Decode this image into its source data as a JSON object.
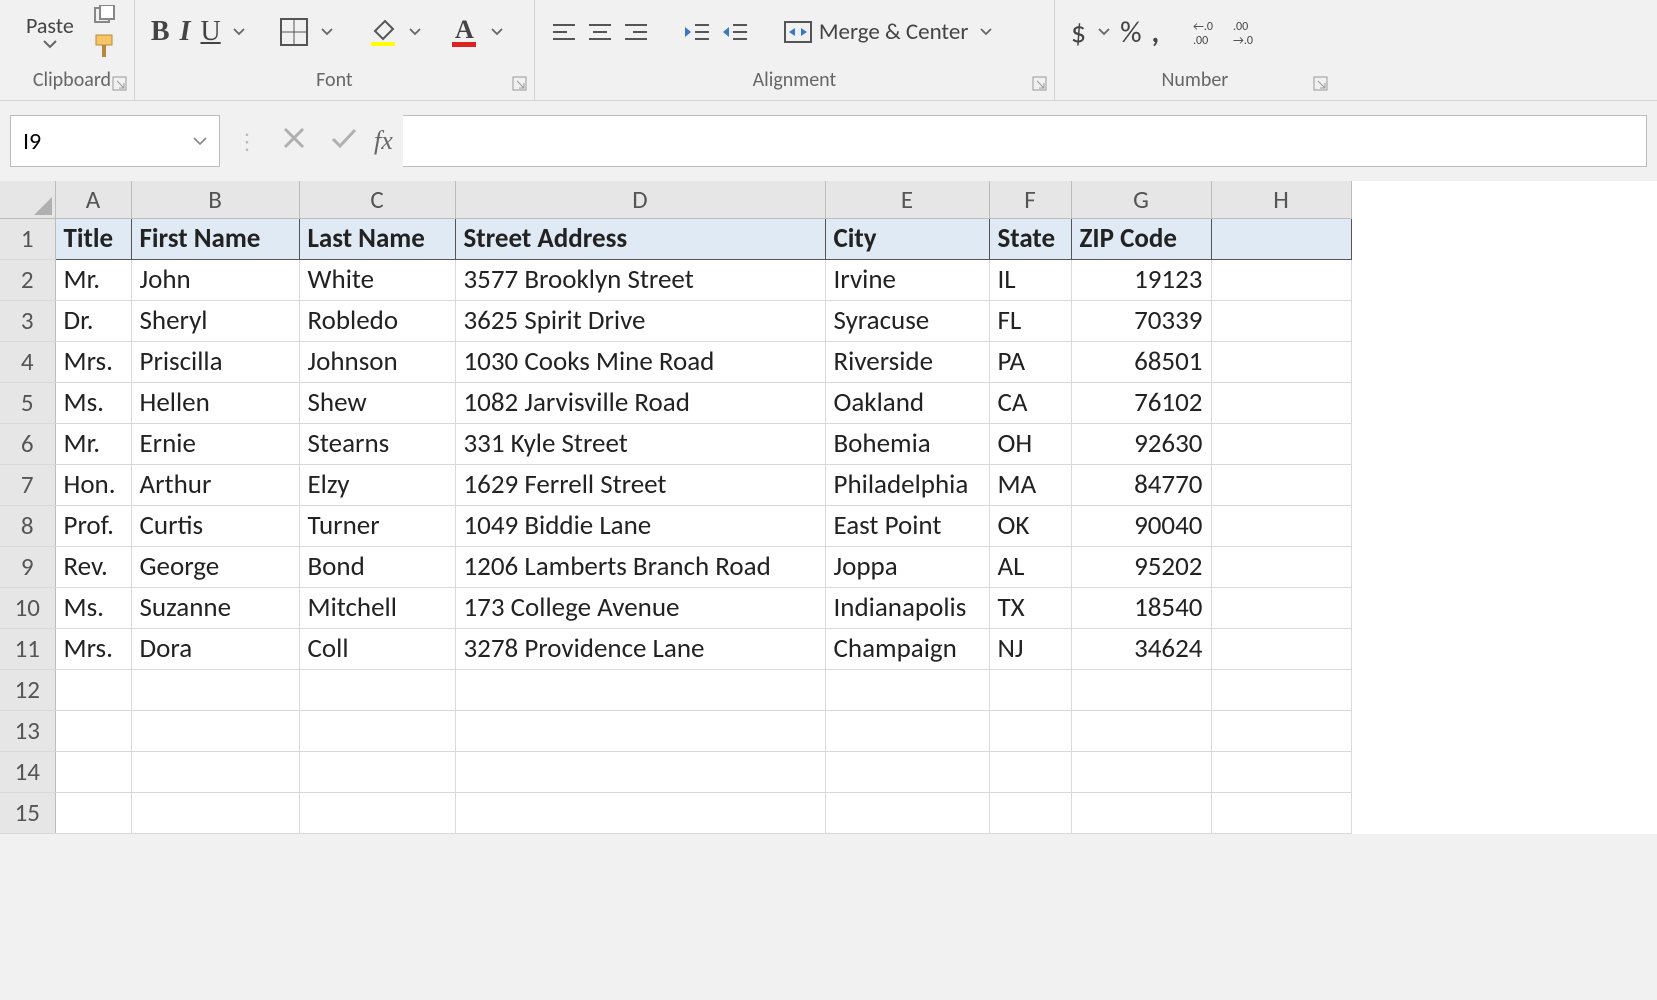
{
  "ribbon": {
    "clipboard": {
      "paste": "Paste",
      "group_label": "Clipboard"
    },
    "font": {
      "group_label": "Font"
    },
    "alignment": {
      "merge": "Merge & Center",
      "group_label": "Alignment"
    },
    "number": {
      "currency": "$",
      "percent": "%",
      "comma": ",",
      "group_label": "Number"
    }
  },
  "formula_bar": {
    "name_box": "I9",
    "fx": "fx",
    "value": ""
  },
  "columns": [
    "A",
    "B",
    "C",
    "D",
    "E",
    "F",
    "G",
    "H"
  ],
  "column_widths": [
    "colA",
    "colB",
    "colC",
    "colD",
    "colE",
    "colF",
    "colG",
    "colH"
  ],
  "headers": [
    "Title",
    "First Name",
    "Last Name",
    "Street Address",
    "City",
    "State",
    "ZIP Code"
  ],
  "rows": [
    {
      "n": 2,
      "title": "Mr.",
      "first": "John",
      "last": "White",
      "street": "3577 Brooklyn Street",
      "city": "Irvine",
      "state": "IL",
      "zip": "19123"
    },
    {
      "n": 3,
      "title": "Dr.",
      "first": "Sheryl",
      "last": "Robledo",
      "street": "3625 Spirit Drive",
      "city": "Syracuse",
      "state": "FL",
      "zip": "70339"
    },
    {
      "n": 4,
      "title": "Mrs.",
      "first": "Priscilla",
      "last": "Johnson",
      "street": "1030 Cooks Mine Road",
      "city": "Riverside",
      "state": "PA",
      "zip": "68501"
    },
    {
      "n": 5,
      "title": "Ms.",
      "first": "Hellen",
      "last": "Shew",
      "street": "1082 Jarvisville Road",
      "city": "Oakland",
      "state": "CA",
      "zip": "76102"
    },
    {
      "n": 6,
      "title": "Mr.",
      "first": "Ernie",
      "last": "Stearns",
      "street": "331 Kyle Street",
      "city": "Bohemia",
      "state": "OH",
      "zip": "92630"
    },
    {
      "n": 7,
      "title": "Hon.",
      "first": "Arthur",
      "last": "Elzy",
      "street": "1629 Ferrell Street",
      "city": "Philadelphia",
      "state": "MA",
      "zip": "84770"
    },
    {
      "n": 8,
      "title": "Prof.",
      "first": "Curtis",
      "last": "Turner",
      "street": "1049 Biddie Lane",
      "city": "East Point",
      "state": "OK",
      "zip": "90040"
    },
    {
      "n": 9,
      "title": "Rev.",
      "first": "George",
      "last": "Bond",
      "street": "1206 Lamberts Branch Road",
      "city": "Joppa",
      "state": "AL",
      "zip": "95202"
    },
    {
      "n": 10,
      "title": "Ms.",
      "first": "Suzanne",
      "last": "Mitchell",
      "street": "173 College Avenue",
      "city": "Indianapolis",
      "state": "TX",
      "zip": "18540"
    },
    {
      "n": 11,
      "title": "Mrs.",
      "first": "Dora",
      "last": "Coll",
      "street": "3278 Providence Lane",
      "city": "Champaign",
      "state": "NJ",
      "zip": "34624"
    }
  ],
  "empty_rows": [
    12,
    13,
    14,
    15
  ]
}
